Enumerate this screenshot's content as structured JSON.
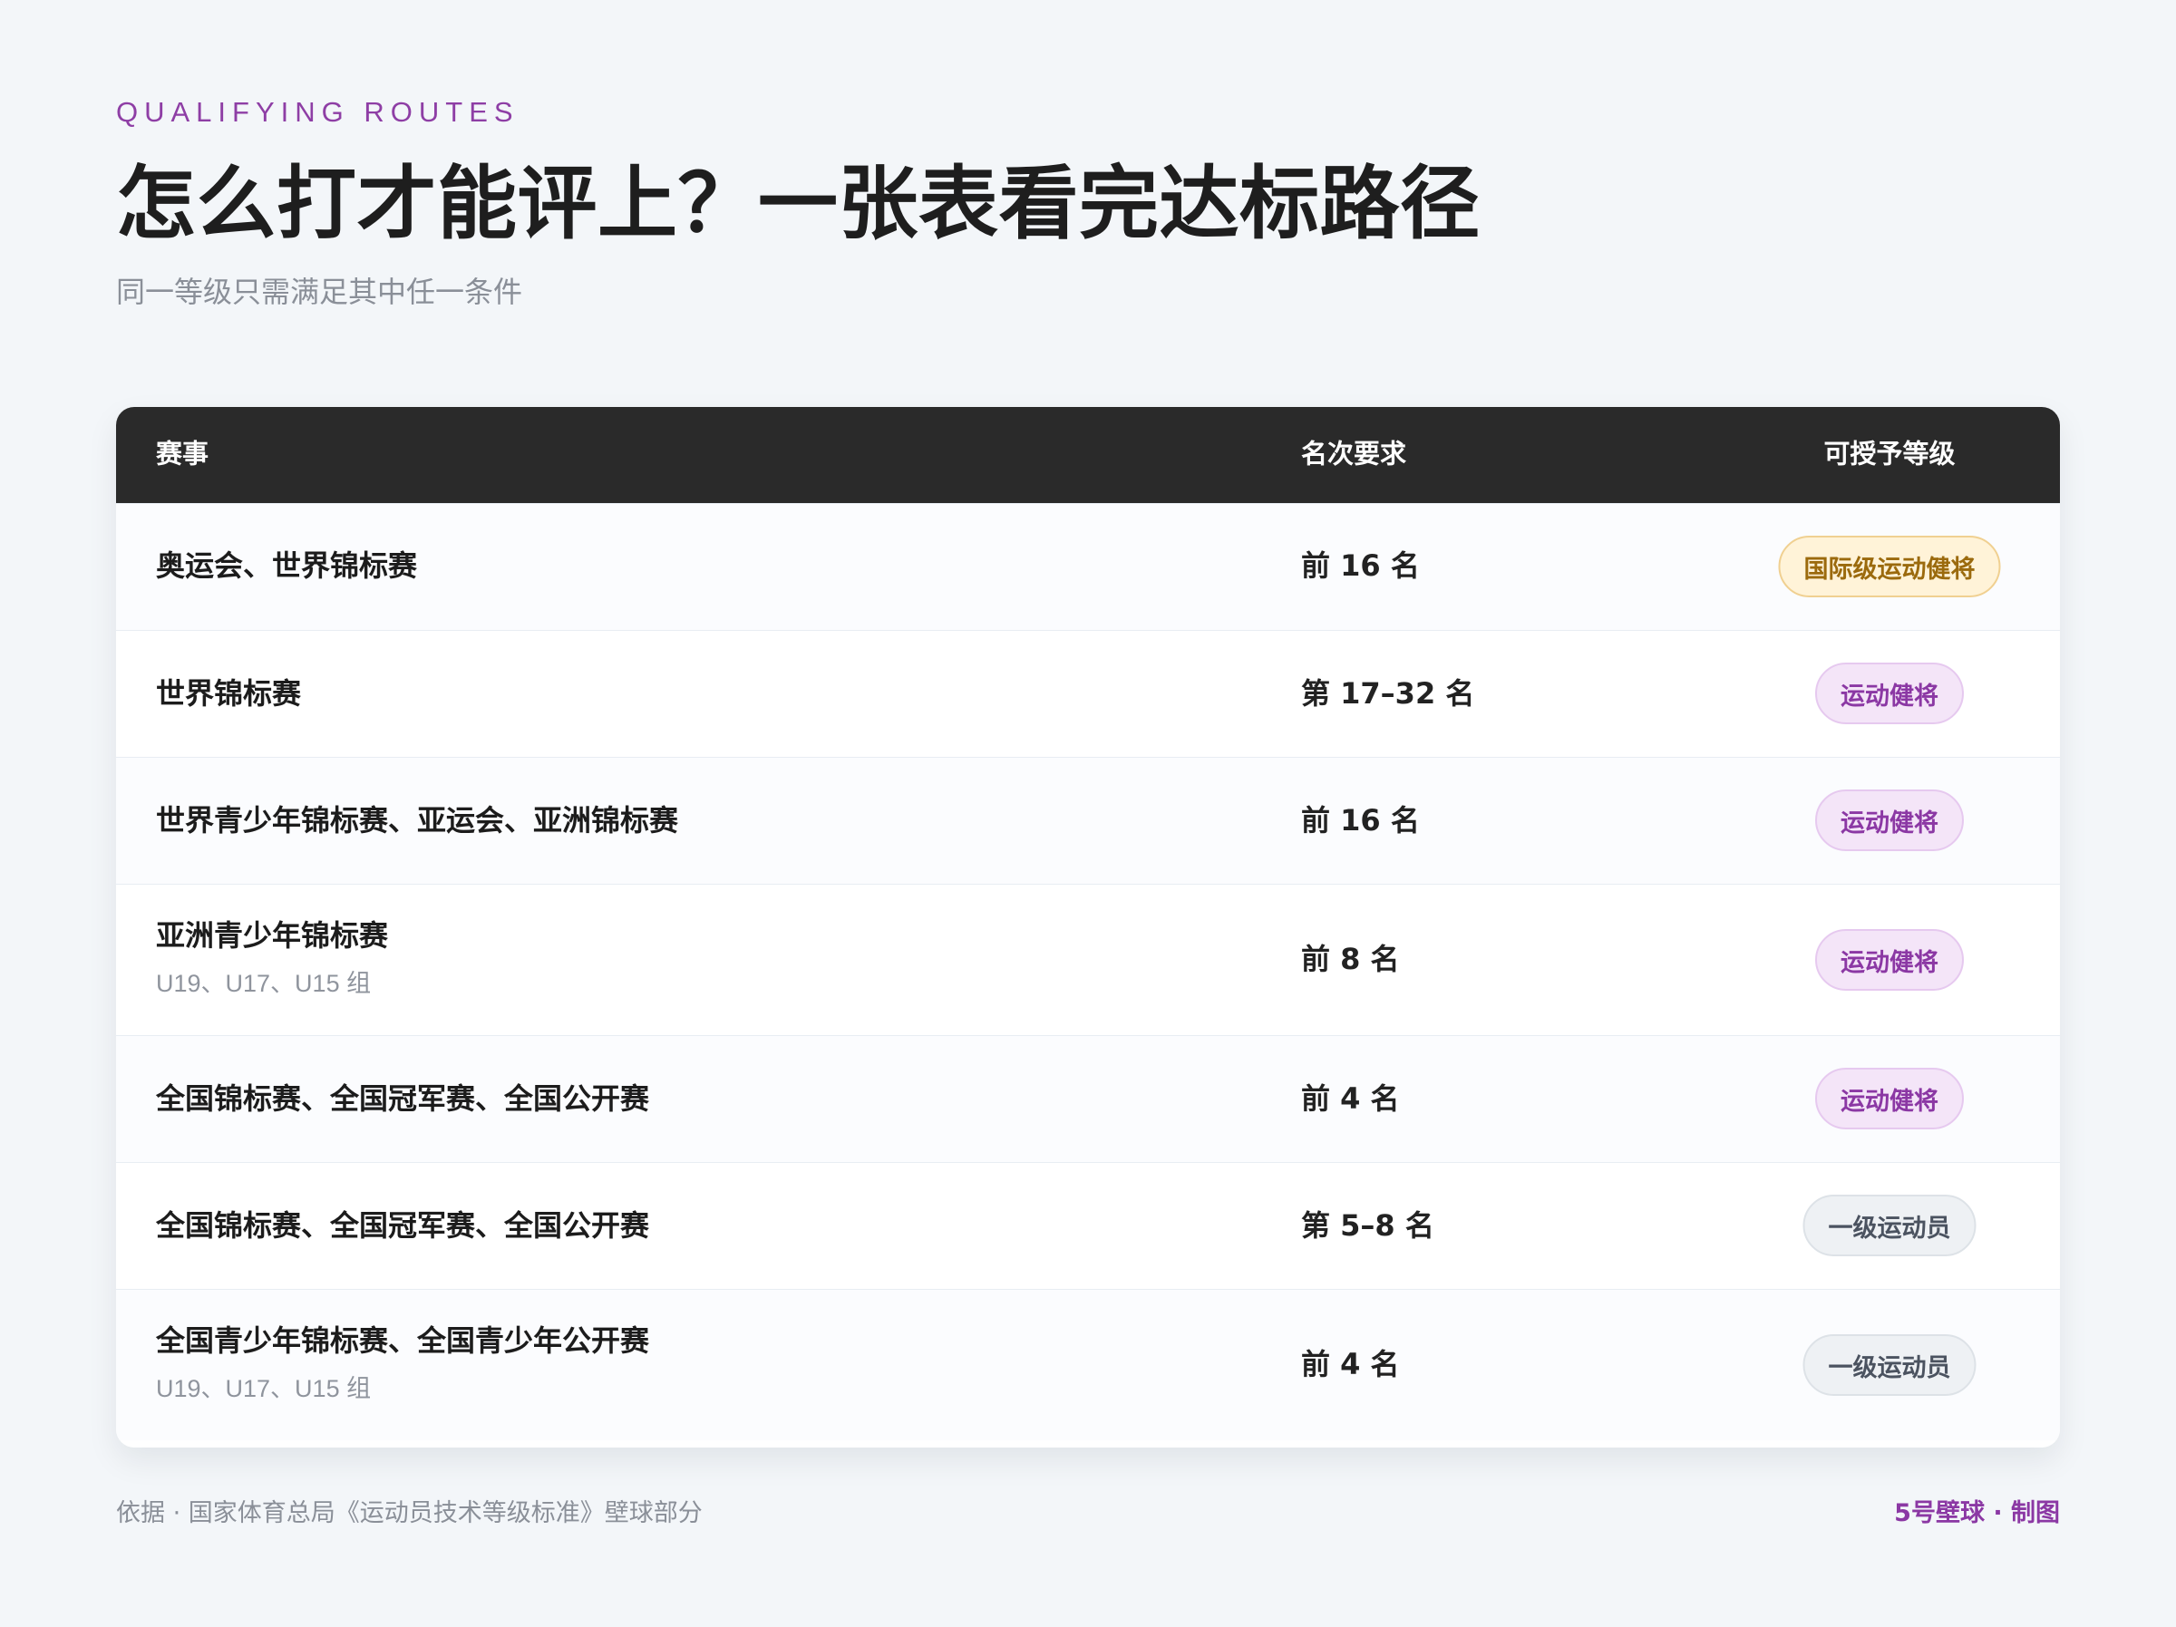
{
  "header": {
    "eyebrow": "QUALIFYING ROUTES",
    "title": "怎么打才能评上？一张表看完达标路径",
    "subtitle": "同一等级只需满足其中任一条件"
  },
  "table": {
    "columns": {
      "event": "赛事",
      "rank": "名次要求",
      "level": "可授予等级"
    },
    "rows": [
      {
        "event": "奥运会、世界锦标赛",
        "sub": "",
        "rank": "前 16 名",
        "level": "国际级运动健将",
        "tone": "gold"
      },
      {
        "event": "世界锦标赛",
        "sub": "",
        "rank": "第 17–32 名",
        "level": "运动健将",
        "tone": "purple"
      },
      {
        "event": "世界青少年锦标赛、亚运会、亚洲锦标赛",
        "sub": "",
        "rank": "前 16 名",
        "level": "运动健将",
        "tone": "purple"
      },
      {
        "event": "亚洲青少年锦标赛",
        "sub": "U19、U17、U15 组",
        "rank": "前 8 名",
        "level": "运动健将",
        "tone": "purple"
      },
      {
        "event": "全国锦标赛、全国冠军赛、全国公开赛",
        "sub": "",
        "rank": "前 4 名",
        "level": "运动健将",
        "tone": "purple"
      },
      {
        "event": "全国锦标赛、全国冠军赛、全国公开赛",
        "sub": "",
        "rank": "第 5–8 名",
        "level": "一级运动员",
        "tone": "gray"
      },
      {
        "event": "全国青少年锦标赛、全国青少年公开赛",
        "sub": "U19、U17、U15 组",
        "rank": "前 4 名",
        "level": "一级运动员",
        "tone": "gray"
      }
    ]
  },
  "footer": {
    "source": "依据 · 国家体育总局《运动员技术等级标准》壁球部分",
    "credit": "5号壁球 · 制图"
  },
  "colors": {
    "accent": "#8b38a4",
    "header_bg": "#2a2a2a",
    "gold_badge": "#fff3d8",
    "purple_badge": "#f4e5f8",
    "gray_badge": "#eef1f4"
  }
}
